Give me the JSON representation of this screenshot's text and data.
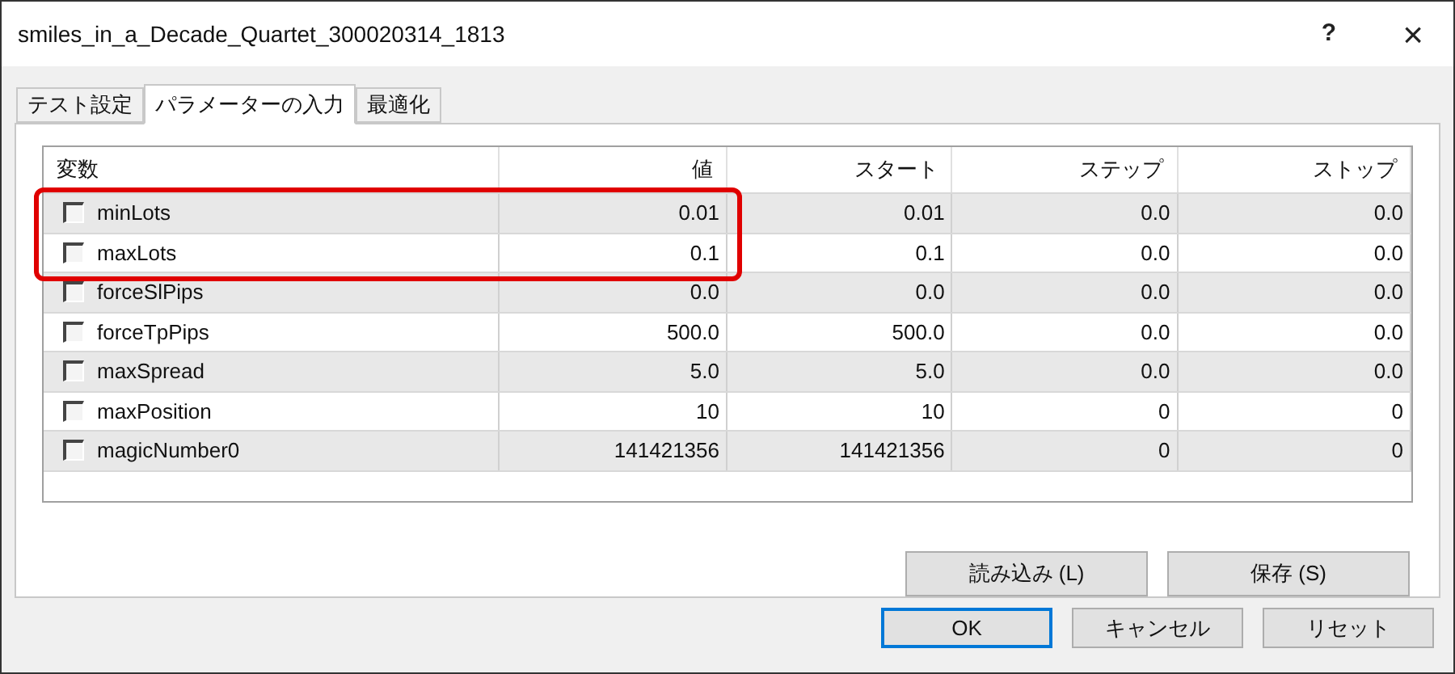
{
  "window": {
    "title": "smiles_in_a_Decade_Quartet_300020314_1813",
    "help": "?",
    "close": "×"
  },
  "tabs": [
    {
      "label": "テスト設定",
      "selected": false
    },
    {
      "label": "パラメーターの入力",
      "selected": true
    },
    {
      "label": "最適化",
      "selected": false
    }
  ],
  "table": {
    "columns": [
      "変数",
      "値",
      "スタート",
      "ステップ",
      "ストップ"
    ],
    "highlighted_rows": [
      {
        "checked": false,
        "cells": [
          "minLots",
          "0.01",
          "0.01",
          "0.0",
          "0.0"
        ]
      },
      {
        "checked": false,
        "cells": [
          "maxLots",
          "0.1",
          "0.1",
          "0.0",
          "0.0"
        ]
      }
    ],
    "rows": [
      {
        "checked": false,
        "cells": [
          "forceSlPips",
          "0.0",
          "0.0",
          "0.0",
          "0.0"
        ]
      },
      {
        "checked": false,
        "cells": [
          "forceTpPips",
          "500.0",
          "500.0",
          "0.0",
          "0.0"
        ]
      },
      {
        "checked": false,
        "cells": [
          "maxSpread",
          "5.0",
          "5.0",
          "0.0",
          "0.0"
        ]
      },
      {
        "checked": false,
        "cells": [
          "maxPosition",
          "10",
          "10",
          "0",
          "0"
        ]
      },
      {
        "checked": false,
        "cells": [
          "magicNumber0",
          "141421356",
          "141421356",
          "0",
          "0"
        ]
      }
    ]
  },
  "panel_buttons": [
    "読み込み (L)",
    "保存 (S)"
  ],
  "dialog_buttons": [
    {
      "label": "OK",
      "default": true
    },
    {
      "label": "キャンセル",
      "default": false
    },
    {
      "label": "リセット",
      "default": false
    }
  ]
}
